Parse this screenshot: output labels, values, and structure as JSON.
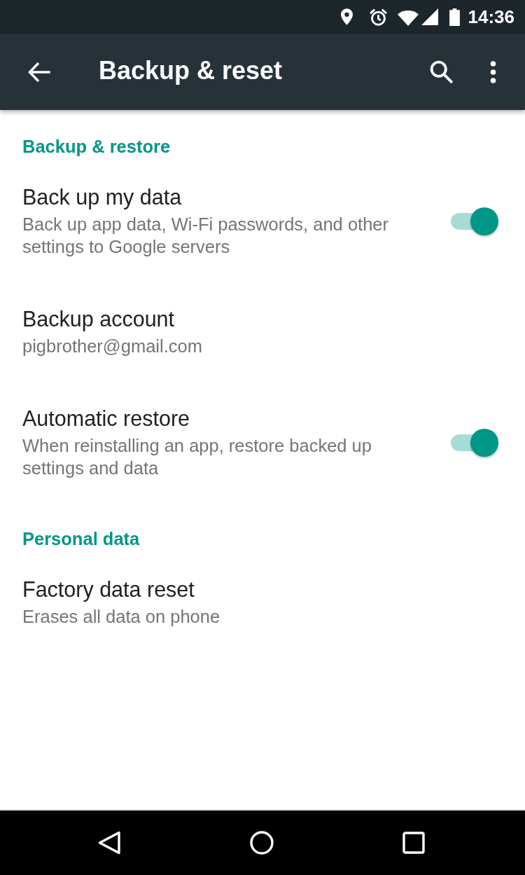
{
  "status_bar": {
    "time": "14:36"
  },
  "app_bar": {
    "title": "Backup & reset"
  },
  "sections": [
    {
      "header": "Backup & restore",
      "items": [
        {
          "kind": "toggle",
          "title": "Back up my data",
          "summary": "Back up app data, Wi-Fi passwords, and other settings to Google servers",
          "on": true
        },
        {
          "kind": "plain",
          "title": "Backup account",
          "summary": "pigbrother@gmail.com"
        },
        {
          "kind": "toggle",
          "title": "Automatic restore",
          "summary": "When reinstalling an app, restore backed up settings and data",
          "on": true
        }
      ]
    },
    {
      "header": "Personal data",
      "items": [
        {
          "kind": "plain",
          "title": "Factory data reset",
          "summary": "Erases all data on phone"
        }
      ]
    }
  ]
}
